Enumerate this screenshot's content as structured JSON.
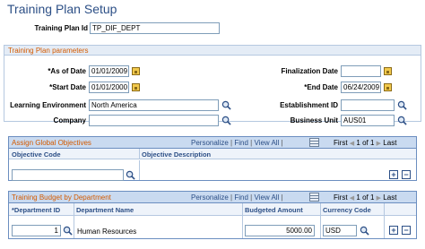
{
  "page": {
    "title": "Training Plan Setup",
    "training_plan_id_label": "Training Plan Id",
    "training_plan_id_value": "TP_DIF_DEPT"
  },
  "params": {
    "group_title": "Training Plan parameters",
    "as_of_date_label": "*As of Date",
    "as_of_date_value": "01/01/2009",
    "start_date_label": "*Start Date",
    "start_date_value": "01/01/2000",
    "finalization_date_label": "Finalization Date",
    "finalization_date_value": "",
    "end_date_label": "*End Date",
    "end_date_value": "06/24/2009",
    "learning_env_label": "Learning Environment",
    "learning_env_value": "North America",
    "establishment_label": "Establishment ID",
    "establishment_value": "",
    "company_label": "Company",
    "company_value": "",
    "business_unit_label": "Business Unit",
    "business_unit_value": "AUS01"
  },
  "objectives_grid": {
    "title": "Assign Global Objectives",
    "personalize": "Personalize",
    "find": "Find",
    "view_all": "View All",
    "first": "First",
    "page_info": "1 of 1",
    "last": "Last",
    "col_code": "Objective Code",
    "col_desc": "Objective Description",
    "row_code_value": ""
  },
  "budget_grid": {
    "title": "Training Budget by Department",
    "personalize": "Personalize",
    "find": "Find",
    "view_all": "View All",
    "first": "First",
    "page_info": "1 of 1",
    "last": "Last",
    "col_dept_id": "*Department ID",
    "col_dept_name": "Department Name",
    "col_amount": "Budgeted Amount",
    "col_currency": "Currency Code",
    "row_dept_id": "1",
    "row_dept_name": "Human Resources",
    "row_amount": "5000.00",
    "row_currency": "USD"
  },
  "icons": {
    "calendar": "calendar-icon",
    "lookup": "magnifier-icon",
    "grid_view": "grid-view-icon",
    "add_row": "+",
    "delete_row": "−"
  },
  "colors": {
    "title": "#2c4f86",
    "group_heading": "#d35a00",
    "grid_border": "#6b8ec0"
  }
}
